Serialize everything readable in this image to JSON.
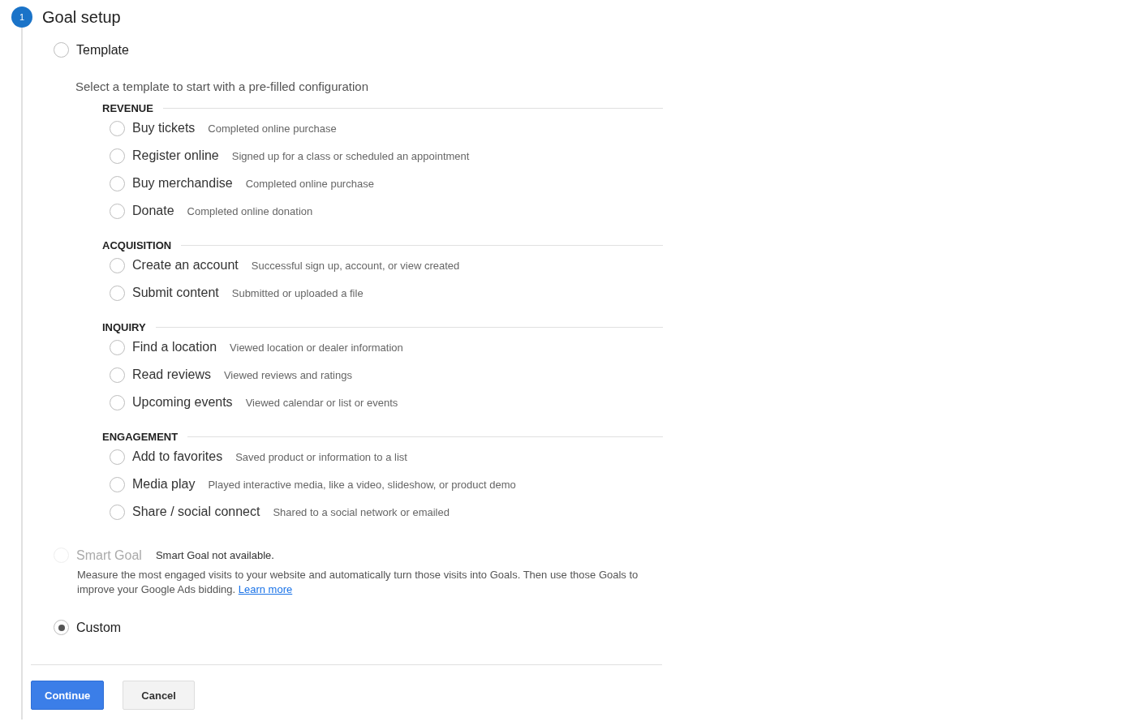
{
  "step": {
    "number": "1",
    "title": "Goal setup"
  },
  "options": [
    {
      "kind": "template",
      "label": "Template",
      "selected": false,
      "disabled": false,
      "description": "Select a template to start with a pre-filled configuration",
      "groups": [
        {
          "heading": "REVENUE",
          "items": [
            {
              "label": "Buy tickets",
              "description": "Completed online purchase",
              "selected": false
            },
            {
              "label": "Register online",
              "description": "Signed up for a class or scheduled an appointment",
              "selected": false
            },
            {
              "label": "Buy merchandise",
              "description": "Completed online purchase",
              "selected": false
            },
            {
              "label": "Donate",
              "description": "Completed online donation",
              "selected": false
            }
          ]
        },
        {
          "heading": "ACQUISITION",
          "items": [
            {
              "label": "Create an account",
              "description": "Successful sign up, account, or view created",
              "selected": false
            },
            {
              "label": "Submit content",
              "description": "Submitted or uploaded a file",
              "selected": false
            }
          ]
        },
        {
          "heading": "INQUIRY",
          "items": [
            {
              "label": "Find a location",
              "description": "Viewed location or dealer information",
              "selected": false
            },
            {
              "label": "Read reviews",
              "description": "Viewed reviews and ratings",
              "selected": false
            },
            {
              "label": "Upcoming events",
              "description": "Viewed calendar or list or events",
              "selected": false
            }
          ]
        },
        {
          "heading": "ENGAGEMENT",
          "items": [
            {
              "label": "Add to favorites",
              "description": "Saved product or information to a list",
              "selected": false
            },
            {
              "label": "Media play",
              "description": "Played interactive media, like a video, slideshow, or product demo",
              "selected": false
            },
            {
              "label": "Share / social connect",
              "description": "Shared to a social network or emailed",
              "selected": false
            }
          ]
        }
      ]
    },
    {
      "kind": "smart",
      "label": "Smart Goal",
      "selected": false,
      "disabled": true,
      "note": "Smart Goal not available.",
      "description": "Measure the most engaged visits to your website and automatically turn those visits into Goals. Then use those Goals to improve your Google Ads bidding.",
      "link": "Learn more"
    },
    {
      "kind": "custom",
      "label": "Custom",
      "selected": true,
      "disabled": false
    }
  ],
  "buttons": [
    {
      "label": "Continue",
      "kind": "primary"
    },
    {
      "label": "Cancel",
      "kind": "secondary"
    }
  ]
}
